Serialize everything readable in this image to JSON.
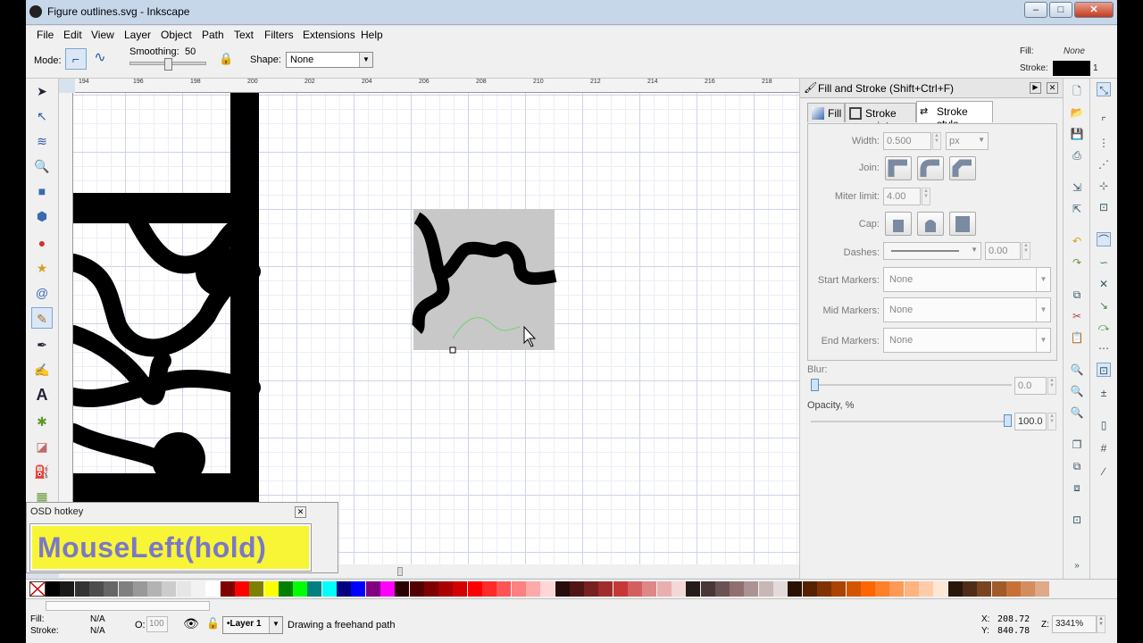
{
  "window": {
    "title": "Figure outlines.svg - Inkscape"
  },
  "menu": [
    "File",
    "Edit",
    "View",
    "Layer",
    "Object",
    "Path",
    "Text",
    "Filters",
    "Extensions",
    "Help"
  ],
  "toolctrl": {
    "mode_label": "Mode:",
    "smoothing_label": "Smoothing:",
    "smoothing_value": "50",
    "smoothing_fraction": 0.5,
    "shape_label": "Shape:",
    "shape_value": "None"
  },
  "style_indicator": {
    "fill_label": "Fill:",
    "fill_value": "None",
    "stroke_label": "Stroke:",
    "stroke_width": "1",
    "stroke_color": "#000000"
  },
  "ruler": {
    "labels": [
      "194",
      "196",
      "198",
      "200",
      "202",
      "204",
      "206",
      "208",
      "210",
      "212",
      "214",
      "216",
      "218"
    ]
  },
  "dock": {
    "title": "Fill and Stroke (Shift+Ctrl+F)",
    "tabs": [
      "Fill",
      "Stroke paint",
      "Stroke style"
    ],
    "width_label": "Width:",
    "width_value": "0.500",
    "width_unit": "px",
    "join_label": "Join:",
    "miter_label": "Miter limit:",
    "miter_value": "4.00",
    "cap_label": "Cap:",
    "dashes_label": "Dashes:",
    "dashes_value": "0.00",
    "start_markers_label": "Start Markers:",
    "start_markers_value": "None",
    "mid_markers_label": "Mid Markers:",
    "mid_markers_value": "None",
    "end_markers_label": "End Markers:",
    "end_markers_value": "None",
    "blur_label": "Blur:",
    "blur_value": "0.0",
    "blur_fraction": 0.0,
    "opacity_label": "Opacity, %",
    "opacity_value": "100.0",
    "opacity_fraction": 1.0
  },
  "osd": {
    "title": "OSD hotkey",
    "text": "MouseLeft(hold)"
  },
  "palette": [
    "#000000",
    "#1a1a1a",
    "#333333",
    "#4d4d4d",
    "#666666",
    "#808080",
    "#999999",
    "#b3b3b3",
    "#cccccc",
    "#e6e6e6",
    "#f2f2f2",
    "#ffffff",
    "#800000",
    "#ff0000",
    "#808000",
    "#ffff00",
    "#008000",
    "#00ff00",
    "#008080",
    "#00ffff",
    "#000080",
    "#0000ff",
    "#800080",
    "#ff00ff",
    "#2b0000",
    "#550000",
    "#800000",
    "#aa0000",
    "#d40000",
    "#ff0000",
    "#ff2a2a",
    "#ff5555",
    "#ff8080",
    "#ffaaaa",
    "#ffd5d5",
    "#280b0b",
    "#501616",
    "#782121",
    "#a02c2c",
    "#c83737",
    "#d35f5f",
    "#de8787",
    "#e9afaf",
    "#f4d7d7",
    "#241c1c",
    "#483737",
    "#6c5353",
    "#916f6f",
    "#ac9393",
    "#c8b7b7",
    "#e3dbdb",
    "#2b1100",
    "#552200",
    "#803300",
    "#aa4400",
    "#d45500",
    "#ff6600",
    "#ff7f2a",
    "#ff9955",
    "#ffb380",
    "#ffccaa",
    "#ffe6d5",
    "#28170b",
    "#502d16",
    "#784421",
    "#a05a2c",
    "#c87137",
    "#d38d5f",
    "#deaa87"
  ],
  "status": {
    "fill_label": "Fill:",
    "fill_value": "N/A",
    "stroke_label": "Stroke:",
    "stroke_value": "N/A",
    "opacity_label": "O:",
    "opacity_value": "100",
    "layer": "•Layer 1",
    "message": "Drawing a freehand path",
    "x_label": "X:",
    "x_value": "208.72",
    "y_label": "Y:",
    "y_value": "840.78",
    "zoom_label": "Z:",
    "zoom_value": "3341%"
  }
}
